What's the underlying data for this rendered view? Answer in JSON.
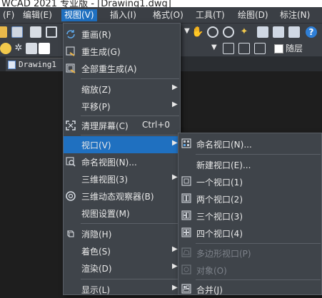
{
  "window": {
    "title": "WCAD 2021 专业版 - [Drawing1.dwg]"
  },
  "menubar": {
    "items": [
      {
        "label": "(F)"
      },
      {
        "label": "编辑(E)"
      },
      {
        "label": "视图(V)"
      },
      {
        "label": "插入(I)"
      },
      {
        "label": "格式(O)"
      },
      {
        "label": "工具(T)"
      },
      {
        "label": "绘图(D)"
      },
      {
        "label": "标注(N)"
      }
    ]
  },
  "toolbar": {
    "layer_name": "随层"
  },
  "file_tab": {
    "label": "Drawing1"
  },
  "view_menu": {
    "items": [
      {
        "label": "重画(R)",
        "icon": "redraw-icon"
      },
      {
        "label": "重生成(G)",
        "icon": "regen-icon"
      },
      {
        "label": "全部重生成(A)",
        "icon": "regen-all-icon"
      },
      {
        "label": "缩放(Z)",
        "has_submenu": true
      },
      {
        "label": "平移(P)",
        "has_submenu": true
      },
      {
        "label": "清理屏幕(C)",
        "shortcut": "Ctrl+0",
        "icon": "clean-screen-icon"
      },
      {
        "label": "视口(V)",
        "has_submenu": true,
        "highlighted": true
      },
      {
        "label": "命名视图(N)...",
        "icon": "named-view-icon"
      },
      {
        "label": "三维视图(3)",
        "has_submenu": true
      },
      {
        "label": "三维动态观察器(B)",
        "icon": "orbit-icon"
      },
      {
        "label": "视图设置(M)"
      },
      {
        "label": "消隐(H)",
        "icon": "hide-icon"
      },
      {
        "label": "着色(S)",
        "has_submenu": true
      },
      {
        "label": "渲染(D)",
        "has_submenu": true
      },
      {
        "label": "显示(L)",
        "has_submenu": true
      }
    ]
  },
  "viewport_submenu": {
    "items": [
      {
        "label": "命名视口(N)...",
        "icon": "named-viewport-icon"
      },
      {
        "label": "新建视口(E)..."
      },
      {
        "label": "一个视口(1)",
        "icon": "one-viewport-icon"
      },
      {
        "label": "两个视口(2)",
        "icon": "two-viewports-icon"
      },
      {
        "label": "三个视口(3)",
        "icon": "three-viewports-icon"
      },
      {
        "label": "四个视口(4)",
        "icon": "four-viewports-icon"
      },
      {
        "label": "多边形视口(P)",
        "icon": "polygon-viewport-icon",
        "disabled": true
      },
      {
        "label": "对象(O)",
        "icon": "object-viewport-icon",
        "disabled": true
      },
      {
        "label": "合并(J)",
        "icon": "join-viewport-icon"
      }
    ]
  },
  "colors": {
    "accent": "#1f70c0",
    "menu_bg": "#3f444a",
    "bar_bg": "#3b3f45",
    "canvas_bg": "#1e1e1e"
  }
}
